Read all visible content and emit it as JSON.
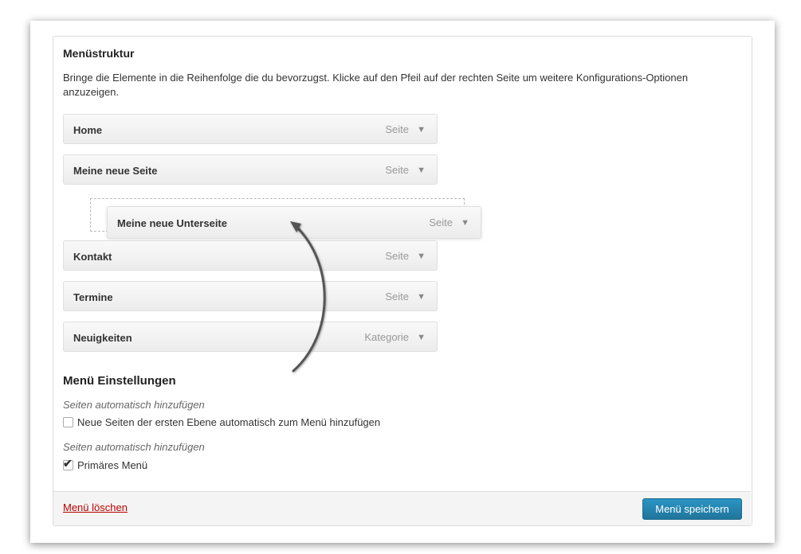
{
  "menu_structure": {
    "title": "Menüstruktur",
    "description": "Bringe die Elemente in die Reihenfolge die du bevorzugst. Klicke auf den Pfeil auf der rechten Seite um weitere Konfigurations-Optionen anzuzeigen.",
    "items": [
      {
        "label": "Home",
        "type": "Seite"
      },
      {
        "label": "Meine neue Seite",
        "type": "Seite"
      },
      {
        "label": "Meine neue Unterseite",
        "type": "Seite"
      },
      {
        "label": "Kontakt",
        "type": "Seite"
      },
      {
        "label": "Termine",
        "type": "Seite"
      },
      {
        "label": "Neuigkeiten",
        "type": "Kategorie"
      }
    ],
    "expand_icon": "triangle-down-icon"
  },
  "menu_settings": {
    "title": "Menü Einstellungen",
    "auto_add": {
      "label": "Seiten automatisch hinzufügen",
      "option": "Neue Seiten der ersten Ebene automatisch zum Menü hinzufügen",
      "checked": false
    },
    "location": {
      "label": "Seiten automatisch hinzufügen",
      "option": "Primäres Menü",
      "checked": true
    }
  },
  "footer": {
    "delete_label": "Menü löschen",
    "save_label": "Menü speichern"
  },
  "colors": {
    "primary_button": "#21759b",
    "delete_link": "#bb0000"
  }
}
